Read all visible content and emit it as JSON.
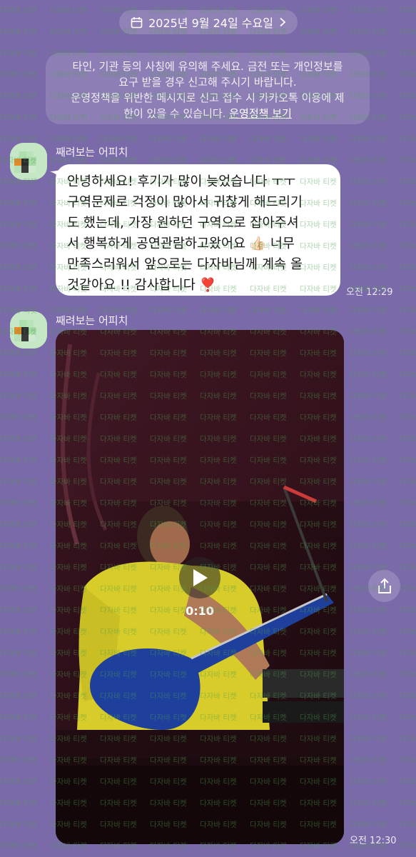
{
  "date_header": {
    "label": "2025년 9월 24일 수요일",
    "calendar_icon": "calendar-icon",
    "chevron_icon": "chevron-right-icon"
  },
  "notice": {
    "line1": "타인, 기관 등의 사칭에 유의해 주세요. 금전 또는 개인정보를",
    "line2": "요구 받을 경우 신고해 주시기 바랍니다.",
    "line3": "운영정책을 위반한 메시지로 신고 접수 시 카카오톡 이용에 제",
    "line4_prefix": "한이 있을 수 있습니다. ",
    "line4_link": "운영정책 보기"
  },
  "messages": [
    {
      "sender": "째려보는 어피치",
      "lines": [
        "안녕하세요! 후기가 많이 늦었습니다 ㅜㅜ",
        "구역문제로 걱정이 많아서 귀찮게 해드리기",
        "도 했는데, 가장 원하던 구역으로 잡아주셔",
        "서 행복하게 공연관람하고왔어요 👍🏻 너무",
        "만족스러워서 앞으로는 다자바님께 계속 올",
        "것같아요 !! 감사합니다 ❣️"
      ],
      "time": "오전 12:29"
    },
    {
      "sender": "째려보는 어피치",
      "video_duration": "0:10",
      "time": "오전 12:30"
    }
  ],
  "watermark": "다자바 티켓",
  "colors": {
    "background": "#7b6aa9",
    "bubble": "#ffffff",
    "watermark": "#4ea04e"
  }
}
